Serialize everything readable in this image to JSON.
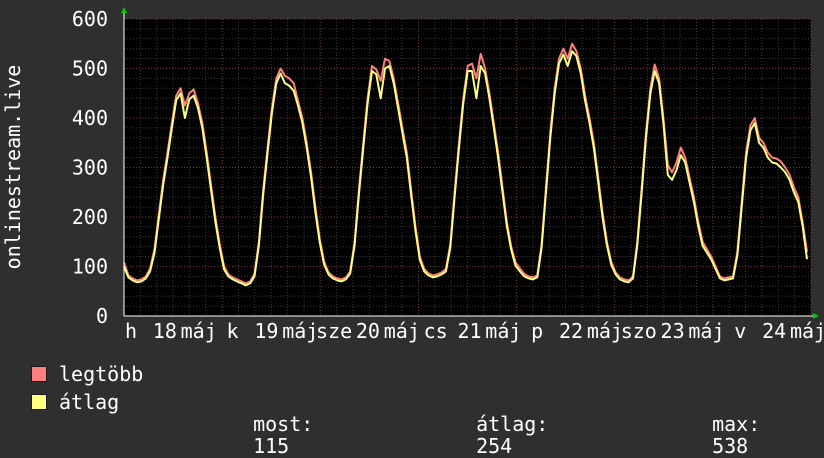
{
  "chart_data": {
    "type": "line",
    "ylabel": "onlinestream.live",
    "ylim": [
      0,
      600
    ],
    "yticks": [
      0,
      100,
      200,
      300,
      400,
      500,
      600
    ],
    "grid": true,
    "x_tick_labels": [
      "h",
      "18",
      "máj",
      "k",
      "19",
      "máj",
      "sze",
      "20",
      "máj",
      "cs",
      "21",
      "máj",
      "p",
      "22",
      "máj",
      "szo",
      "23",
      "máj",
      "v",
      "24",
      "máj"
    ],
    "x_days": [
      "18",
      "19",
      "20",
      "21",
      "22",
      "23",
      "24"
    ],
    "series": [
      {
        "name": "legtöbb",
        "color": "#ff7f7f",
        "values": [
          108,
          82,
          76,
          72,
          74,
          80,
          96,
          135,
          205,
          275,
          330,
          390,
          445,
          460,
          425,
          450,
          458,
          430,
          390,
          330,
          265,
          200,
          145,
          100,
          84,
          78,
          74,
          70,
          66,
          70,
          85,
          150,
          255,
          340,
          420,
          480,
          500,
          485,
          480,
          470,
          435,
          400,
          350,
          290,
          220,
          155,
          110,
          88,
          80,
          76,
          74,
          78,
          90,
          150,
          255,
          350,
          440,
          505,
          498,
          475,
          520,
          515,
          480,
          430,
          380,
          330,
          255,
          180,
          120,
          95,
          86,
          82,
          84,
          88,
          95,
          145,
          250,
          350,
          440,
          505,
          510,
          480,
          530,
          500,
          450,
          390,
          330,
          260,
          190,
          140,
          108,
          96,
          85,
          80,
          78,
          82,
          145,
          260,
          370,
          460,
          520,
          540,
          520,
          550,
          535,
          500,
          445,
          400,
          350,
          280,
          210,
          150,
          110,
          88,
          78,
          74,
          72,
          80,
          150,
          260,
          370,
          460,
          508,
          480,
          400,
          305,
          290,
          310,
          340,
          320,
          280,
          240,
          190,
          150,
          135,
          120,
          100,
          80,
          76,
          78,
          80,
          130,
          230,
          330,
          385,
          400,
          360,
          350,
          330,
          320,
          318,
          312,
          300,
          285,
          260,
          240,
          190,
          130
        ]
      },
      {
        "name": "átlag",
        "color": "#ffff80",
        "values": [
          100,
          78,
          72,
          68,
          70,
          76,
          90,
          128,
          196,
          265,
          320,
          380,
          436,
          450,
          400,
          438,
          445,
          420,
          380,
          320,
          255,
          190,
          138,
          94,
          80,
          74,
          70,
          66,
          62,
          66,
          80,
          143,
          245,
          330,
          410,
          470,
          490,
          470,
          465,
          455,
          425,
          390,
          340,
          280,
          210,
          148,
          104,
          84,
          76,
          72,
          70,
          74,
          86,
          143,
          245,
          340,
          430,
          495,
          488,
          440,
          500,
          505,
          470,
          420,
          370,
          320,
          245,
          172,
          114,
          90,
          82,
          78,
          80,
          84,
          90,
          138,
          240,
          340,
          430,
          495,
          495,
          440,
          505,
          490,
          440,
          380,
          320,
          250,
          182,
          134,
          102,
          90,
          80,
          76,
          74,
          78,
          138,
          250,
          360,
          450,
          510,
          528,
          505,
          535,
          525,
          490,
          435,
          390,
          340,
          270,
          200,
          143,
          104,
          84,
          74,
          70,
          68,
          76,
          143,
          250,
          360,
          450,
          495,
          470,
          390,
          285,
          275,
          295,
          325,
          310,
          270,
          230,
          182,
          142,
          128,
          114,
          95,
          76,
          72,
          74,
          76,
          123,
          220,
          320,
          375,
          390,
          350,
          340,
          320,
          310,
          308,
          300,
          290,
          275,
          250,
          230,
          182,
          115
        ]
      }
    ]
  },
  "legend": {
    "max_label": "legtöbb",
    "avg_label": "átlag"
  },
  "stats": {
    "now_label": "most:",
    "now_value": "115",
    "avg_label": "átlag:",
    "avg_value": "254",
    "max_label": "max:",
    "max_value": "538"
  }
}
